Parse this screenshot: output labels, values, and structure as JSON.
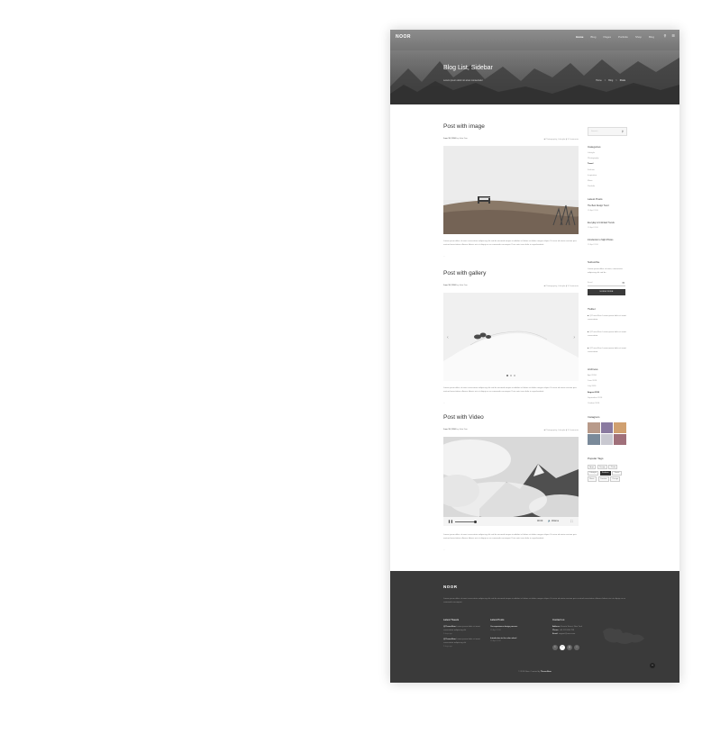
{
  "header": {
    "logo": "NOOR",
    "nav": [
      "Home",
      "Blog",
      "Pages",
      "Portfolio",
      "Shop",
      "Blog"
    ],
    "icons": [
      "search-icon",
      "menu-icon"
    ],
    "title": "Blog List, Sidebar",
    "subtitle": "Lorem ipsum dolor sit amet consectetur",
    "breadcrumb": [
      "Home",
      "Blog",
      "Posts"
    ]
  },
  "posts": [
    {
      "title": "Post with image",
      "date": "June 18, 2016",
      "author": "by John Doe",
      "category": "Photography, Lifestyle",
      "comments": "3 Comments",
      "text": "Lorem ipsum dolor sit amet consectetur adipiscing elit sed do eiusmod tempor incididunt ut labore et dolore magna aliqua. Ut enim ad minim veniam quis nostrud exercitation ullamco laboris nisi ut aliquip ex ea commodo consequat. Duis aute irure dolor in reprehenderit.",
      "more": "..."
    },
    {
      "title": "Post with gallery",
      "date": "June 18, 2016",
      "author": "by John Doe",
      "category": "Photography, Lifestyle",
      "comments": "3 Comments",
      "text": "Lorem ipsum dolor sit amet consectetur adipiscing elit sed do eiusmod tempor incididunt ut labore et dolore magna aliqua. Ut enim ad minim veniam quis nostrud exercitation ullamco laboris nisi ut aliquip ex ea commodo consequat. Duis aute irure dolor in reprehenderit.",
      "more": "..."
    },
    {
      "title": "Post with Video",
      "date": "June 18, 2016",
      "author": "by John Doe",
      "category": "Photography, Lifestyle",
      "comments": "3 Comments",
      "text": "Lorem ipsum dolor sit amet consectetur adipiscing elit sed do eiusmod tempor incididunt ut labore et dolore magna aliqua. Ut enim ad minim veniam quis nostrud exercitation ullamco laboris nisi ut aliquip ex ea commodo consequat. Duis aute irure dolor in reprehenderit.",
      "more": "...",
      "player": {
        "time": "00:00",
        "volume": "Volume",
        "progress": 0.4
      }
    }
  ],
  "sidebar": {
    "search_placeholder": "Search...",
    "categories_title": "Categories",
    "categories": [
      "Lifestyle",
      "Photography",
      "Travel",
      "Fashion",
      "Inspiration",
      "Music",
      "Portfolio"
    ],
    "active_category": 2,
    "latest_title": "Latest Posts",
    "latest": [
      {
        "title": "The Best Design Trend",
        "date": "12 April 2016"
      },
      {
        "title": "Everyday is Unlimited Trends",
        "date": "12 April 2016"
      },
      {
        "title": "Introduction to Night Photos",
        "date": "12 April 2016"
      }
    ],
    "subscribe_title": "Subscribe",
    "subscribe_text": "Lorem ipsum dolor sit amet, consectetur adipiscing elit sed do",
    "email_placeholder": "Email",
    "subscribe_button": "SUBSCRIBE",
    "twitter_title": "Twitter",
    "tweets": [
      {
        "handle": "@ThemeNoor",
        "text": "Lorem ipsum dolor sit amet consectetur"
      },
      {
        "handle": "@ThemeNoor",
        "text": "Lorem ipsum dolor sit amet consectetur"
      },
      {
        "handle": "@ThemeNoor",
        "text": "Lorem ipsum dolor sit amet consectetur"
      }
    ],
    "archives_title": "Archives",
    "archives": [
      "April 2016",
      "June 2016",
      "July 2016",
      "August 2016",
      "September 2016",
      "October 2016"
    ],
    "active_archive": 3,
    "instagram_title": "Instagram",
    "tags_title": "Popular Tags",
    "tags": [
      "Apps",
      "Design",
      "Photo",
      "Lifestyle",
      "Fashion",
      "Travel",
      "Music",
      "Creative",
      "Design"
    ],
    "active_tag": 4
  },
  "footer": {
    "logo": "NOOR",
    "description": "Lorem ipsum dolor sit amet consectetur adipiscing elit sed do eiusmod tempor incididunt ut labore et dolore magna aliqua. Ut enim ad minim veniam quis nostrud exercitation ullamco laboris nisi ut aliquip ex ea commodo consequat.",
    "tweets_title": "Latest Tweets",
    "tweets": [
      {
        "handle": "@ThemeNoor",
        "text": "Lorem ipsum dolor sit amet consectetur adipiscing elit",
        "time": "2 days ago"
      },
      {
        "handle": "@ThemeNoor",
        "text": "Lorem ipsum dolor sit amet consectetur adipiscing elit",
        "time": "2 days ago"
      }
    ],
    "posts_title": "Latest Posts",
    "posts": [
      {
        "title": "Our experience design process",
        "date": "12 April 2016"
      },
      {
        "title": "Introduction to the color wheel",
        "date": "12 April 2016"
      }
    ],
    "contact_title": "Contact us",
    "contact": [
      {
        "label": "Address:",
        "value": "Envato Street, New York"
      },
      {
        "label": "Phone:",
        "value": "+00 123 456 789"
      },
      {
        "label": "Email:",
        "value": "support@noor.com"
      }
    ],
    "social": [
      "twitter-icon",
      "facebook-icon",
      "googleplus-icon",
      "dribbble-icon"
    ],
    "copyright": "© 2016 Noor. Created by",
    "copyright_brand": "ThemeNoor",
    "totop": "^"
  }
}
